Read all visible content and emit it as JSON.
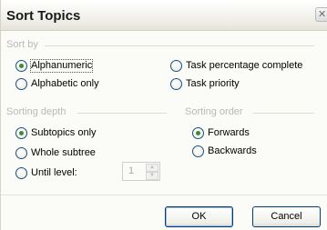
{
  "dialog": {
    "title": "Sort Topics",
    "close_glyph": "✕"
  },
  "sort_by": {
    "title": "Sort by",
    "options": [
      {
        "label": "Alphanumeric",
        "checked": true
      },
      {
        "label": "Alphabetic only",
        "checked": false
      },
      {
        "label": "Task percentage complete",
        "checked": false
      },
      {
        "label": "Task priority",
        "checked": false
      }
    ]
  },
  "sorting_depth": {
    "title": "Sorting depth",
    "options": [
      {
        "label": "Subtopics only",
        "checked": true
      },
      {
        "label": "Whole subtree",
        "checked": false
      },
      {
        "label": "Until level:",
        "checked": false
      }
    ],
    "level_value": "1",
    "spinner_up_glyph": "▲",
    "spinner_down_glyph": "▼"
  },
  "sorting_order": {
    "title": "Sorting order",
    "options": [
      {
        "label": "Forwards",
        "checked": true
      },
      {
        "label": "Backwards",
        "checked": false
      }
    ]
  },
  "buttons": {
    "ok": "OK",
    "cancel": "Cancel"
  }
}
